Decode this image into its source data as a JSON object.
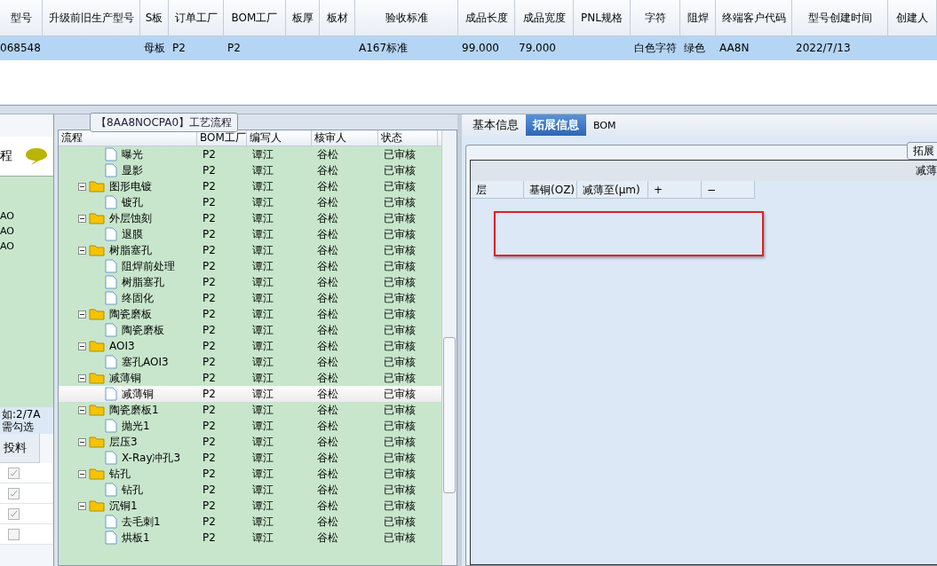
{
  "main_table": {
    "columns": [
      "型号",
      "升级前旧生产型号",
      "S板",
      "订单工厂",
      "BOM工厂",
      "板厚",
      "板材",
      "验收标准",
      "成品长度",
      "成品宽度",
      "PNL规格",
      "字符",
      "阻焊",
      "终端客户代码",
      "型号创建时间",
      "创建人"
    ],
    "rows": [
      {
        "selected": true,
        "cells": [
          "068548",
          "",
          "母板",
          "P2",
          "P2",
          "",
          "",
          "A167标准",
          "99.000",
          "79.000",
          "",
          "白色字符",
          "绿色",
          "AA8N",
          "2022/7/13",
          ""
        ]
      }
    ]
  },
  "left_panel": {
    "title": "程",
    "items": [
      "AO",
      "AO",
      "AO"
    ],
    "hint_lines": [
      "如:2/7A",
      "需勾选"
    ],
    "column": "投料",
    "checks": [
      {
        "checked": true
      },
      {
        "checked": true
      },
      {
        "checked": true
      },
      {
        "checked": false
      }
    ]
  },
  "process_tree": {
    "title": "【8AA8NOCPA0】工艺流程",
    "columns": [
      "流程",
      "BOM工厂",
      "编写人",
      "核审人",
      "状态"
    ],
    "leading": [
      {
        "label": "曝光",
        "bom": "P2",
        "writer": "谭江",
        "reviewer": "谷松",
        "status": "已审核",
        "selected": false
      },
      {
        "label": "显影",
        "bom": "P2",
        "writer": "谭江",
        "reviewer": "谷松",
        "status": "已审核",
        "selected": false
      }
    ],
    "nodes": [
      {
        "label": "图形电镀",
        "bom": "P2",
        "writer": "谭江",
        "reviewer": "谷松",
        "status": "已审核",
        "selected": false,
        "expanded": true,
        "children": [
          {
            "label": "镀孔",
            "bom": "P2",
            "writer": "谭江",
            "reviewer": "谷松",
            "status": "已审核",
            "selected": false
          }
        ]
      },
      {
        "label": "外层蚀刻",
        "bom": "P2",
        "writer": "谭江",
        "reviewer": "谷松",
        "status": "已审核",
        "selected": false,
        "expanded": true,
        "children": [
          {
            "label": "退膜",
            "bom": "P2",
            "writer": "谭江",
            "reviewer": "谷松",
            "status": "已审核",
            "selected": false
          }
        ]
      },
      {
        "label": "树脂塞孔",
        "bom": "P2",
        "writer": "谭江",
        "reviewer": "谷松",
        "status": "已审核",
        "selected": false,
        "expanded": true,
        "children": [
          {
            "label": "阻焊前处理",
            "bom": "P2",
            "writer": "谭江",
            "reviewer": "谷松",
            "status": "已审核",
            "selected": false
          },
          {
            "label": "树脂塞孔",
            "bom": "P2",
            "writer": "谭江",
            "reviewer": "谷松",
            "status": "已审核",
            "selected": false
          },
          {
            "label": "终固化",
            "bom": "P2",
            "writer": "谭江",
            "reviewer": "谷松",
            "status": "已审核",
            "selected": false
          }
        ]
      },
      {
        "label": "陶瓷磨板",
        "bom": "P2",
        "writer": "谭江",
        "reviewer": "谷松",
        "status": "已审核",
        "selected": false,
        "expanded": true,
        "children": [
          {
            "label": "陶瓷磨板",
            "bom": "P2",
            "writer": "谭江",
            "reviewer": "谷松",
            "status": "已审核",
            "selected": false
          }
        ]
      },
      {
        "label": "AOI3",
        "bom": "P2",
        "writer": "谭江",
        "reviewer": "谷松",
        "status": "已审核",
        "selected": false,
        "expanded": true,
        "children": [
          {
            "label": "塞孔AOI3",
            "bom": "P2",
            "writer": "谭江",
            "reviewer": "谷松",
            "status": "已审核",
            "selected": false
          }
        ]
      },
      {
        "label": "减薄铜",
        "bom": "P2",
        "writer": "谭江",
        "reviewer": "谷松",
        "status": "已审核",
        "selected": false,
        "expanded": true,
        "children": [
          {
            "label": "减薄铜",
            "bom": "P2",
            "writer": "谭江",
            "reviewer": "谷松",
            "status": "已审核",
            "selected": true
          }
        ]
      },
      {
        "label": "陶瓷磨板1",
        "bom": "P2",
        "writer": "谭江",
        "reviewer": "谷松",
        "status": "已审核",
        "selected": false,
        "expanded": true,
        "children": [
          {
            "label": "抛光1",
            "bom": "P2",
            "writer": "谭江",
            "reviewer": "谷松",
            "status": "已审核",
            "selected": false
          }
        ]
      },
      {
        "label": "层压3",
        "bom": "P2",
        "writer": "谭江",
        "reviewer": "谷松",
        "status": "已审核",
        "selected": false,
        "expanded": true,
        "children": [
          {
            "label": "X-Ray冲孔3",
            "bom": "P2",
            "writer": "谭江",
            "reviewer": "谷松",
            "status": "已审核",
            "selected": false
          }
        ]
      },
      {
        "label": "钻孔",
        "bom": "P2",
        "writer": "谭江",
        "reviewer": "谷松",
        "status": "已审核",
        "selected": false,
        "expanded": true,
        "children": [
          {
            "label": "钻孔",
            "bom": "P2",
            "writer": "谭江",
            "reviewer": "谷松",
            "status": "已审核",
            "selected": false
          }
        ]
      },
      {
        "label": "沉铜1",
        "bom": "P2",
        "writer": "谭江",
        "reviewer": "谷松",
        "status": "已审核",
        "selected": false,
        "expanded": true,
        "children": [
          {
            "label": "去毛刺1",
            "bom": "P2",
            "writer": "谭江",
            "reviewer": "谷松",
            "status": "已审核",
            "selected": false
          },
          {
            "label": "烘板1",
            "bom": "P2",
            "writer": "谭江",
            "reviewer": "谷松",
            "status": "已审核",
            "selected": false
          }
        ]
      }
    ]
  },
  "detail_panel": {
    "tabs": [
      {
        "label": "基本信息",
        "selected": false
      },
      {
        "label": "拓展信息",
        "selected": true
      },
      {
        "label": "BOM",
        "selected": false
      }
    ],
    "group_button": "拓展",
    "grid": {
      "title": "减薄",
      "columns": [
        "层",
        "基铜(OZ)",
        "减薄至(μm)",
        "+",
        "−"
      ]
    }
  }
}
